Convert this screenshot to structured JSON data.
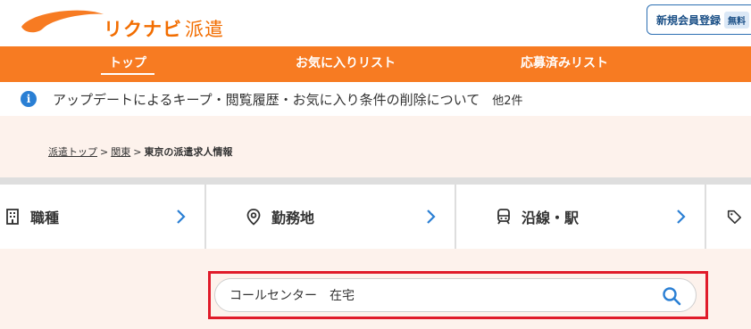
{
  "header": {
    "logo_text": "リクナビ",
    "logo_sub": "派遣",
    "register_label": "新規会員登録",
    "register_badge": "無料"
  },
  "nav": {
    "items": [
      {
        "label": "トップ",
        "active": true
      },
      {
        "label": "お気に入りリスト",
        "active": false
      },
      {
        "label": "応募済みリスト",
        "active": false
      }
    ]
  },
  "notice": {
    "icon": "info-icon",
    "text": "アップデートによるキープ・閲覧履歴・お気に入り条件の削除について",
    "count": "他2件"
  },
  "breadcrumb": {
    "items": [
      "派遣トップ",
      "関東"
    ],
    "separator": ">",
    "current": "東京の派遣求人情報"
  },
  "categories": [
    {
      "label": "職種",
      "icon": "building-icon"
    },
    {
      "label": "勤務地",
      "icon": "map-pin-icon"
    },
    {
      "label": "沿線・駅",
      "icon": "train-icon"
    },
    {
      "label": "",
      "icon": "tag-icon"
    }
  ],
  "search": {
    "value": "コールセンター　在宅",
    "icon": "search-icon"
  },
  "colors": {
    "brand_orange": "#f77b22",
    "accent_blue": "#2a7fd4",
    "highlight_red": "#e01b2a",
    "peach_bg": "#fdf2ec"
  }
}
